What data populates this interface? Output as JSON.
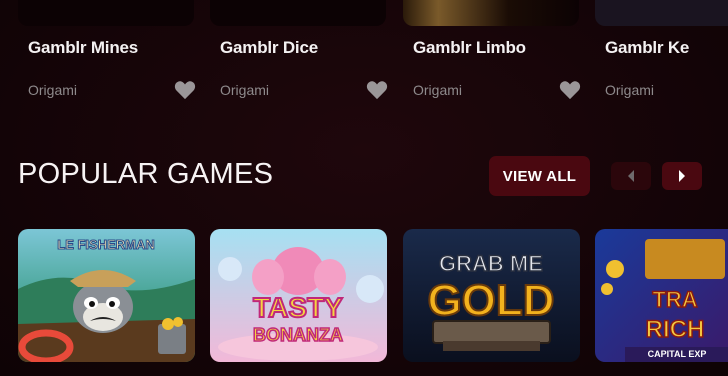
{
  "top_games": [
    {
      "title": "Gamblr Mines",
      "provider": "Origami"
    },
    {
      "title": "Gamblr Dice",
      "provider": "Origami"
    },
    {
      "title": "Gamblr Limbo",
      "provider": "Origami"
    },
    {
      "title": "Gamblr Ke",
      "provider": "Origami"
    }
  ],
  "popular": {
    "title": "POPULAR GAMES",
    "view_all_label": "VIEW ALL",
    "prev_icon": "chevron-left-icon",
    "next_icon": "chevron-right-icon"
  },
  "popular_games": [
    {
      "logo_line1": "LE FISHERMAN",
      "logo_line2": ""
    },
    {
      "logo_line1": "TASTY",
      "logo_line2": "BONANZA"
    },
    {
      "logo_line1": "GRAB ME",
      "logo_line2": "GOLD"
    },
    {
      "logo_line1": "TRA",
      "logo_line2": "RICH",
      "logo_line3": "CAPITAL EXP"
    }
  ],
  "colors": {
    "background": "#140508",
    "button_bg": "#4a0810",
    "heart": "#9a9698",
    "provider_text": "#8e8a8c"
  }
}
